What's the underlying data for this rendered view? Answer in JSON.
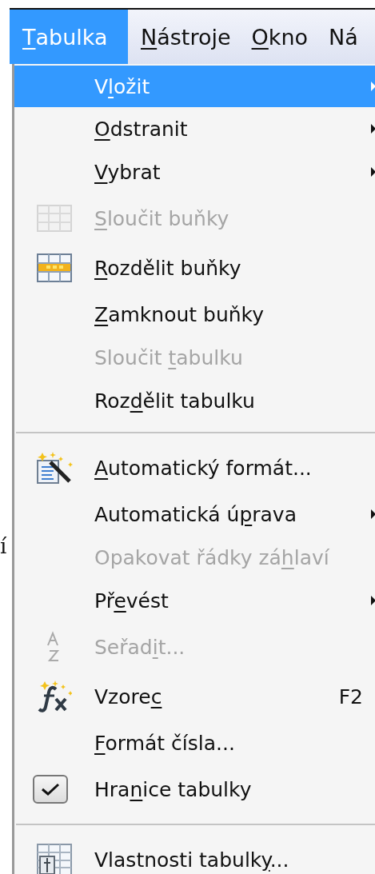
{
  "menubar": [
    {
      "label": {
        "key": "T",
        "after": "abulka"
      },
      "selected": true
    },
    {
      "label": {
        "key": "N",
        "after": "ástroje"
      },
      "selected": false
    },
    {
      "label": {
        "key": "O",
        "after": "kno"
      },
      "selected": false
    },
    {
      "label": {
        "before": "Ná"
      },
      "selected": false
    }
  ],
  "background_text": "í",
  "menu": [
    {
      "kind": "submenu",
      "label": {
        "before": "V",
        "key": "l",
        "after": "ožit"
      },
      "disabled": false,
      "selected": true
    },
    {
      "kind": "submenu",
      "label": {
        "key": "O",
        "after": "dstranit"
      },
      "disabled": false,
      "selected": false
    },
    {
      "kind": "submenu",
      "label": {
        "key": "V",
        "after": "ybrat"
      },
      "disabled": false,
      "selected": false
    },
    {
      "kind": "command",
      "label": {
        "key": "S",
        "after": "loučit buňky"
      },
      "disabled": true,
      "selected": false
    },
    {
      "kind": "command",
      "label": {
        "key": "R",
        "after": "ozdělit buňky"
      },
      "disabled": false,
      "selected": false
    },
    {
      "kind": "command",
      "label": {
        "key": "Z",
        "after": "amknout buňky"
      },
      "disabled": false,
      "selected": false
    },
    {
      "kind": "command",
      "label": {
        "before": "Sloučit ",
        "key": "t",
        "after": "abulku"
      },
      "disabled": true,
      "selected": false
    },
    {
      "kind": "command",
      "label": {
        "before": "Roz",
        "key": "d",
        "after": "ělit tabulku"
      },
      "disabled": false,
      "selected": false
    },
    {
      "kind": "separator"
    },
    {
      "kind": "command",
      "label": {
        "key": "A",
        "after": "utomatický formát..."
      },
      "disabled": false,
      "selected": false
    },
    {
      "kind": "submenu",
      "label": {
        "before": "Automatická ú",
        "key": "p",
        "after": "rava"
      },
      "disabled": false,
      "selected": false
    },
    {
      "kind": "command",
      "label": {
        "before": "Opakovat řádky zá",
        "key": "h",
        "after": "laví"
      },
      "disabled": true,
      "selected": false
    },
    {
      "kind": "submenu",
      "label": {
        "before": "Př",
        "key": "e",
        "after": "vést"
      },
      "disabled": false,
      "selected": false
    },
    {
      "kind": "command",
      "label": {
        "before": "Seřad",
        "key": "i",
        "after": "t..."
      },
      "disabled": true,
      "selected": false
    },
    {
      "kind": "command",
      "label": {
        "before": "Vzore",
        "key": "c"
      },
      "shortcut": "F2",
      "disabled": false,
      "selected": false
    },
    {
      "kind": "command",
      "label": {
        "key": "F",
        "after": "ormát čísla..."
      },
      "disabled": false,
      "selected": false
    },
    {
      "kind": "checkbox",
      "label": {
        "before": "Hra",
        "key": "n",
        "after": "ice tabulky"
      },
      "checked": true,
      "disabled": false,
      "selected": false
    },
    {
      "kind": "separator"
    },
    {
      "kind": "command",
      "label": {
        "before": "Vlastnosti tabulk",
        "key": "y",
        "after": "..."
      },
      "disabled": false,
      "selected": false
    }
  ]
}
